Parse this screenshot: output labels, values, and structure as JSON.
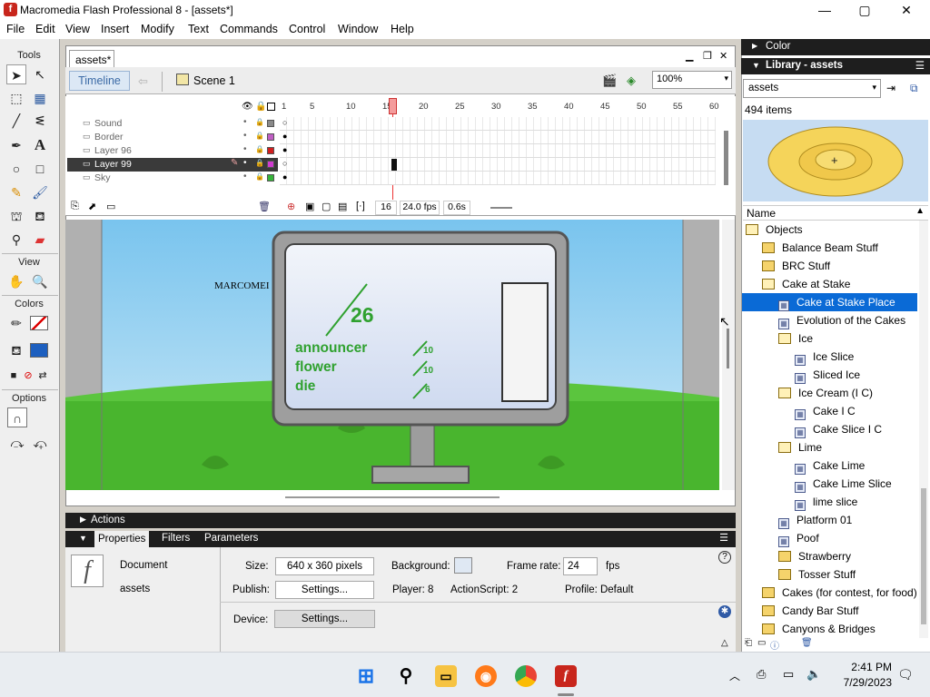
{
  "window": {
    "title": "Macromedia Flash Professional 8 - [assets*]",
    "app_icon": "f",
    "controls": {
      "minimize": "—",
      "maximize": "▢",
      "close": "✕"
    }
  },
  "menu": [
    "File",
    "Edit",
    "View",
    "Insert",
    "Modify",
    "Text",
    "Commands",
    "Control",
    "Window",
    "Help"
  ],
  "tools": {
    "sections": [
      "Tools",
      "View",
      "Colors",
      "Options"
    ]
  },
  "document": {
    "tab": "assets*",
    "timeline_button": "Timeline",
    "scene": "Scene 1",
    "zoom": "100%",
    "doc_controls": {
      "minimize": "▁",
      "restore": "❐",
      "close": "✕"
    }
  },
  "timeline": {
    "ruler": [
      "1",
      "5",
      "10",
      "15",
      "20",
      "25",
      "30",
      "35",
      "40",
      "45",
      "50",
      "55",
      "60"
    ],
    "layers": [
      {
        "name": "Sound",
        "color": "#8a8a8a",
        "selected": false
      },
      {
        "name": "Border",
        "color": "#c05ec4",
        "selected": false
      },
      {
        "name": "Layer 96",
        "color": "#d11f1f",
        "selected": false
      },
      {
        "name": "Layer 99",
        "color": "#d03cd0",
        "selected": true
      },
      {
        "name": "Sky",
        "color": "#36b53a",
        "selected": false
      }
    ],
    "current_frame": "16",
    "fps": "24.0 fps",
    "time": "0.6s"
  },
  "stage": {
    "watermark_text": "MARCOMEI",
    "monitor": {
      "big_number": "26",
      "lines": [
        "announcer",
        "flower",
        "die"
      ],
      "small_numbers": [
        "10",
        "10",
        "6"
      ]
    }
  },
  "panels": {
    "actions": "Actions",
    "tabs": [
      "Properties",
      "Filters",
      "Parameters"
    ]
  },
  "properties": {
    "type": "Document",
    "name": "assets",
    "size_label": "Size:",
    "size_value": "640 x 360 pixels",
    "background_label": "Background:",
    "frame_rate_label": "Frame rate:",
    "frame_rate_value": "24",
    "fps_unit": "fps",
    "publish_label": "Publish:",
    "settings_button": "Settings...",
    "player": "Player: 8",
    "actionscript": "ActionScript:  2",
    "profile": "Profile:  Default",
    "device_label": "Device:",
    "device_settings_button": "Settings..."
  },
  "right_panel": {
    "color_header": "Color",
    "library_header": "Library - assets",
    "library_select": "assets",
    "items_count": "494 items",
    "column_name": "Name",
    "items": [
      {
        "label": "Objects",
        "kind": "folder-open",
        "indent": 0,
        "selected": false
      },
      {
        "label": "Balance Beam Stuff",
        "kind": "folder",
        "indent": 1,
        "selected": false
      },
      {
        "label": "BRC Stuff",
        "kind": "folder",
        "indent": 1,
        "selected": false
      },
      {
        "label": "Cake at Stake",
        "kind": "folder-open",
        "indent": 1,
        "selected": false
      },
      {
        "label": "Cake at Stake Place",
        "kind": "symbol",
        "indent": 2,
        "selected": true
      },
      {
        "label": "Evolution of the Cakes",
        "kind": "symbol",
        "indent": 2,
        "selected": false
      },
      {
        "label": "Ice",
        "kind": "folder-open",
        "indent": 2,
        "selected": false
      },
      {
        "label": "Ice Slice",
        "kind": "symbol",
        "indent": 3,
        "selected": false
      },
      {
        "label": "Sliced Ice",
        "kind": "symbol",
        "indent": 3,
        "selected": false
      },
      {
        "label": "Ice Cream (I C)",
        "kind": "folder-open",
        "indent": 2,
        "selected": false
      },
      {
        "label": "Cake I C",
        "kind": "symbol",
        "indent": 3,
        "selected": false
      },
      {
        "label": "Cake Slice I C",
        "kind": "symbol",
        "indent": 3,
        "selected": false
      },
      {
        "label": "Lime",
        "kind": "folder-open",
        "indent": 2,
        "selected": false
      },
      {
        "label": "Cake Lime",
        "kind": "symbol",
        "indent": 3,
        "selected": false
      },
      {
        "label": "Cake Lime Slice",
        "kind": "symbol",
        "indent": 3,
        "selected": false
      },
      {
        "label": "lime slice",
        "kind": "symbol",
        "indent": 3,
        "selected": false
      },
      {
        "label": "Platform 01",
        "kind": "symbol",
        "indent": 2,
        "selected": false
      },
      {
        "label": "Poof",
        "kind": "symbol",
        "indent": 2,
        "selected": false
      },
      {
        "label": "Strawberry",
        "kind": "folder",
        "indent": 2,
        "selected": false
      },
      {
        "label": "Tosser Stuff",
        "kind": "folder",
        "indent": 2,
        "selected": false
      },
      {
        "label": "Cakes (for contest, for food)",
        "kind": "folder",
        "indent": 1,
        "selected": false
      },
      {
        "label": "Candy Bar Stuff",
        "kind": "folder",
        "indent": 1,
        "selected": false
      },
      {
        "label": "Canyons & Bridges",
        "kind": "folder",
        "indent": 1,
        "selected": false
      }
    ]
  },
  "taskbar": {
    "time": "2:41 PM",
    "date": "7/29/2023"
  }
}
